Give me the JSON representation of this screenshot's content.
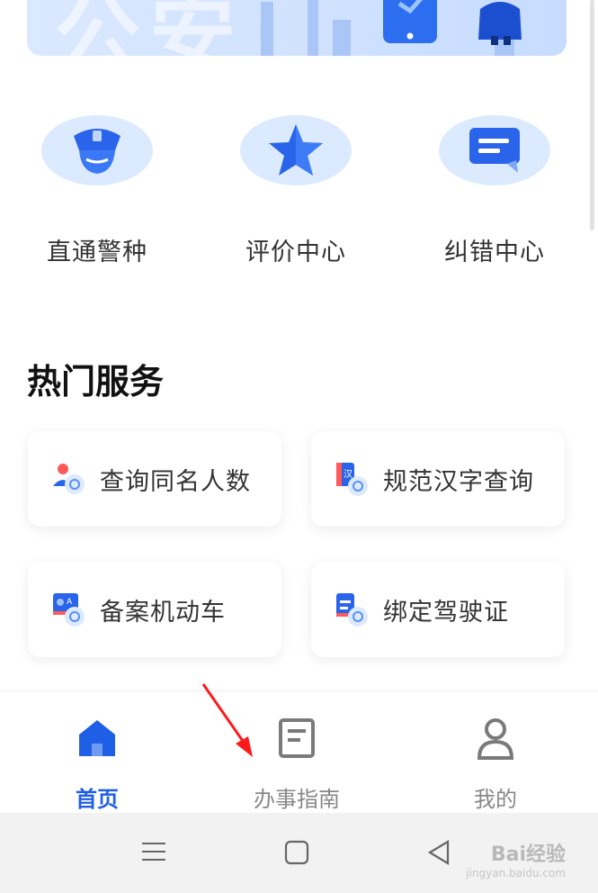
{
  "banner": {
    "watermark_text": "公安"
  },
  "quick_entries": [
    {
      "label": "直通警种",
      "icon": "police-cap-icon"
    },
    {
      "label": "评价中心",
      "icon": "star-icon"
    },
    {
      "label": "纠错中心",
      "icon": "message-icon"
    }
  ],
  "hot_services": {
    "title": "热门服务",
    "items": [
      {
        "label": "查询同名人数",
        "icon": "person-search-icon"
      },
      {
        "label": "规范汉字查询",
        "icon": "chinese-dictionary-icon"
      },
      {
        "label": "备案机动车",
        "icon": "vehicle-register-icon"
      },
      {
        "label": "绑定驾驶证",
        "icon": "driver-license-icon"
      }
    ]
  },
  "tabbar": {
    "tabs": [
      {
        "label": "首页",
        "icon": "home-icon",
        "active": true
      },
      {
        "label": "办事指南",
        "icon": "guide-document-icon",
        "active": false
      },
      {
        "label": "我的",
        "icon": "profile-icon",
        "active": false
      }
    ]
  },
  "watermark": {
    "brand": "Bai经验",
    "url": "jingyan.baidu.com"
  },
  "colors": {
    "accent": "#1f5fe6",
    "icon_bg": "#dceaff",
    "annotation": "#ff1a1a"
  }
}
